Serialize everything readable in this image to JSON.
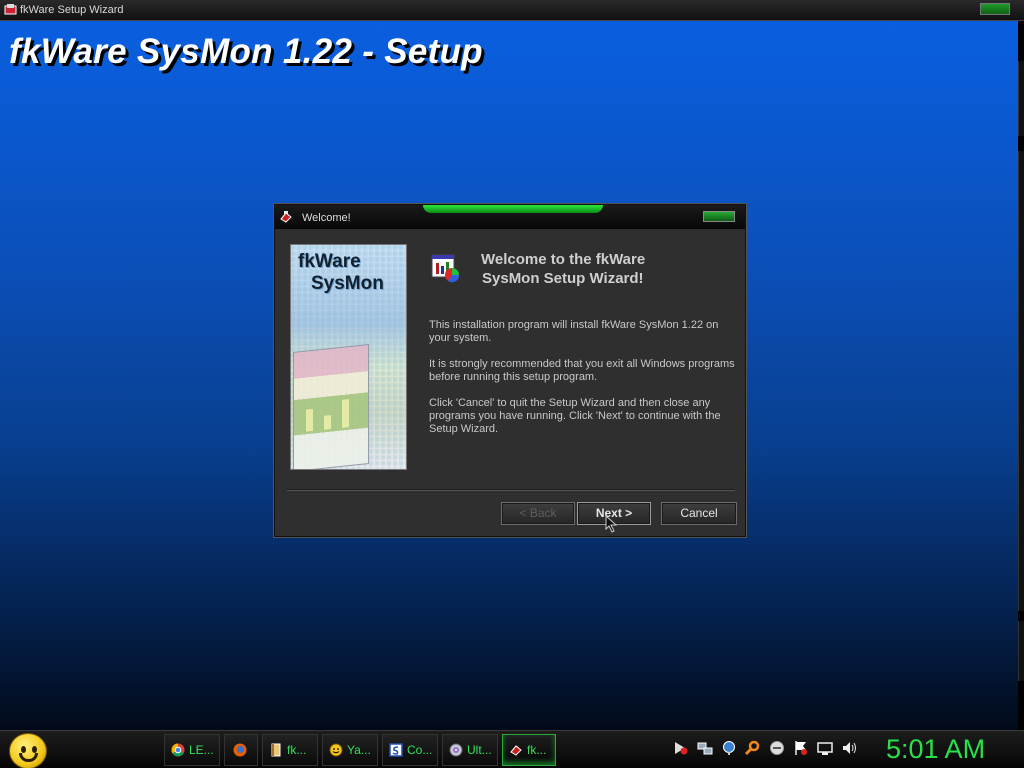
{
  "outer_window": {
    "title": "fkWare Setup Wizard"
  },
  "wizard": {
    "big_title": "fkWare SysMon 1.22 - Setup"
  },
  "dialog": {
    "title": "Welcome!",
    "side_logo_line1": "fkWare",
    "side_logo_line2": "SysMon",
    "heading_line1": "Welcome to the fkWare",
    "heading_line2": "SysMon Setup Wizard!",
    "paragraph1": "This installation program will install fkWare SysMon 1.22 on your system.",
    "paragraph2": "It is strongly recommended that you exit all Windows programs before running this setup program.",
    "paragraph3": "Click 'Cancel' to quit the Setup Wizard and then close any programs you have running.  Click 'Next' to continue with the Setup Wizard.",
    "buttons": {
      "back": "< Back",
      "next": "Next >",
      "cancel": "Cancel"
    }
  },
  "taskbar": {
    "tasks": [
      {
        "label": "LE...",
        "icon": "chrome-icon"
      },
      {
        "label": "",
        "icon": "firefox-icon"
      },
      {
        "label": "fk...",
        "icon": "setup-book-icon"
      },
      {
        "label": "Ya...",
        "icon": "yahoo-smiley-icon"
      },
      {
        "label": "Co...",
        "icon": "console-icon"
      },
      {
        "label": "Ult...",
        "icon": "disc-icon"
      },
      {
        "label": "fk...",
        "icon": "fkware-icon"
      }
    ],
    "clock": "5:01 AM",
    "colors": {
      "accent_green": "#28e04a"
    }
  }
}
